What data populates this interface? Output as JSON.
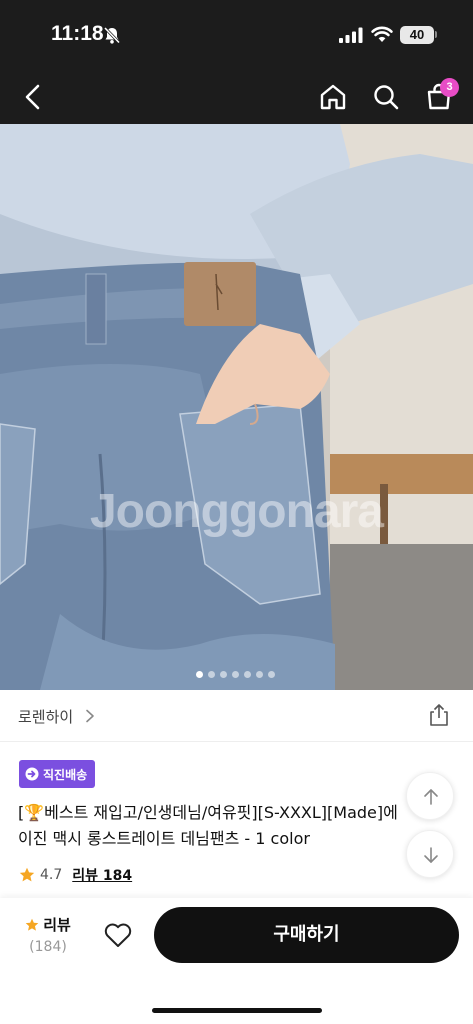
{
  "status_bar": {
    "time": "11:18",
    "battery": "40"
  },
  "nav": {
    "back_icon": "chevron-left-icon",
    "home_icon": "home-icon",
    "search_icon": "search-icon",
    "cart_icon": "shopping-bag-icon",
    "cart_badge": "3",
    "badge_color": "#e84cc6"
  },
  "hero": {
    "watermark": "Joonggonara",
    "slide_count": 7,
    "active_slide": 1
  },
  "brand": {
    "name": "로렌하이",
    "share_icon": "share-icon"
  },
  "product": {
    "badge_label": "직진배송",
    "badge_color": "#7b4fe0",
    "title_line1": "[🏆베스트 재입고/인생데님/여유핏][S-XXXL][Made]에",
    "title_line2": "이진 맥시 롱스트레이트 데님팬츠 - 1 color",
    "rating": "4.7",
    "review_link": "리뷰 184"
  },
  "floating": {
    "up_icon": "arrow-up-icon",
    "down_icon": "arrow-down-icon"
  },
  "bottom_bar": {
    "review_label": "리뷰",
    "review_count": "(184)",
    "wishlist_icon": "heart-icon",
    "buy_label": "구매하기"
  }
}
